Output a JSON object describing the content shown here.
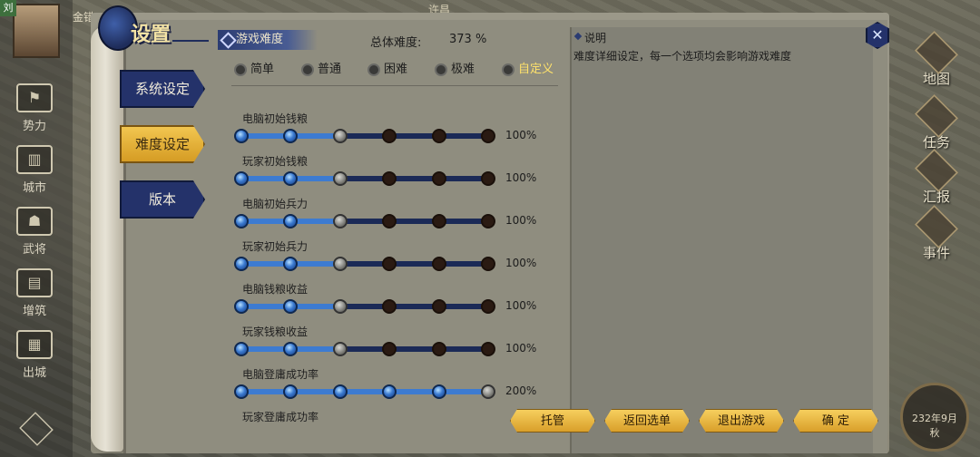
{
  "colors": {
    "accent_gold": "#f2c650",
    "slider_blue": "#3d7bd1",
    "tab_navy": "#24326a",
    "selected_option": "#ffe26b"
  },
  "background": {
    "left_rail": [
      {
        "label": "势力",
        "icon": "flag-icon"
      },
      {
        "label": "城市",
        "icon": "city-icon"
      },
      {
        "label": "武将",
        "icon": "general-icon"
      },
      {
        "label": "增筑",
        "icon": "build-icon"
      },
      {
        "label": "出城",
        "icon": "march-icon"
      }
    ],
    "avatar_tag": "刘",
    "name_tag": "金错",
    "top_tag": "许昌",
    "right_rail": [
      {
        "label": "地图",
        "icon": "map-icon"
      },
      {
        "label": "任务",
        "icon": "quest-icon"
      },
      {
        "label": "汇报",
        "icon": "report-icon"
      },
      {
        "label": "事件",
        "icon": "event-icon"
      }
    ],
    "date": "232年9月",
    "date_sub": "秋"
  },
  "dialog": {
    "title": "设置",
    "tabs": [
      {
        "label": "系统设定",
        "active": false
      },
      {
        "label": "难度设定",
        "active": true
      },
      {
        "label": "版本",
        "active": false
      }
    ],
    "section_title": "游戏难度",
    "total_label": "总体难度:",
    "total_value": "373 %",
    "difficulty_options": [
      {
        "label": "简单",
        "selected": false
      },
      {
        "label": "普通",
        "selected": false
      },
      {
        "label": "困难",
        "selected": false
      },
      {
        "label": "极难",
        "selected": false
      },
      {
        "label": "自定义",
        "selected": true
      }
    ],
    "settings": [
      {
        "label": "电脑初始钱粮",
        "level": 3,
        "value": "100%"
      },
      {
        "label": "玩家初始钱粮",
        "level": 3,
        "value": "100%"
      },
      {
        "label": "电脑初始兵力",
        "level": 3,
        "value": "100%"
      },
      {
        "label": "玩家初始兵力",
        "level": 3,
        "value": "100%"
      },
      {
        "label": "电脑钱粮收益",
        "level": 3,
        "value": "100%"
      },
      {
        "label": "玩家钱粮收益",
        "level": 3,
        "value": "100%"
      },
      {
        "label": "电脑登庸成功率",
        "level": 6,
        "value": "200%"
      },
      {
        "label": "玩家登庸成功率",
        "level": null,
        "value": ""
      }
    ],
    "slider_steps": 6,
    "description_title": "说明",
    "description_text": "难度详细设定，每一个选项均会影响游戏难度",
    "buttons": {
      "trust": "托管",
      "back": "返回选单",
      "exit": "退出游戏",
      "confirm": "确 定"
    }
  }
}
